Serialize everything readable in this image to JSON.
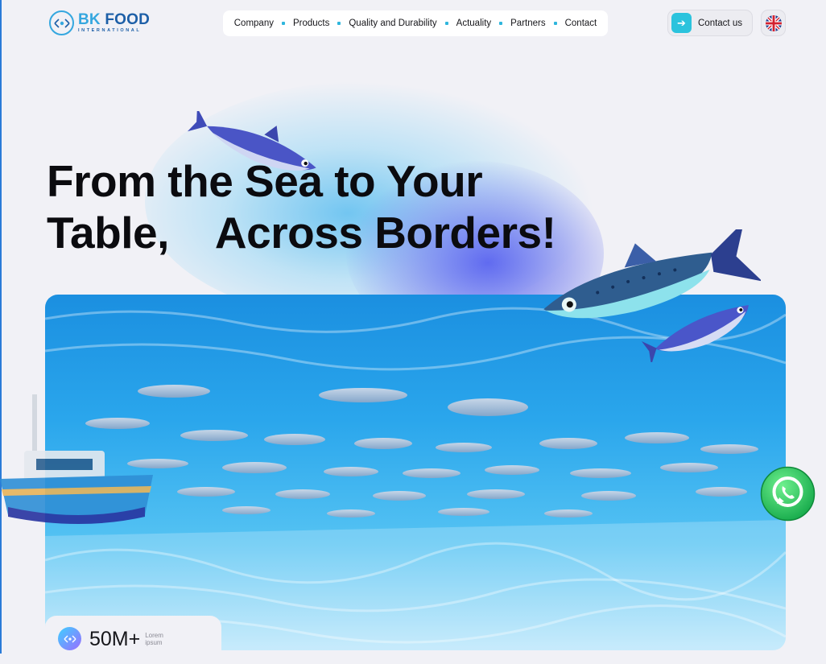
{
  "brand": {
    "name_primary": "BK",
    "name_secondary": "FOOD",
    "tagline": "INTERNATIONAL",
    "accent": "#35a7df",
    "dark": "#1d5fa7"
  },
  "nav": {
    "items": [
      "Company",
      "Products",
      "Quality and Durability",
      "Actuality",
      "Partners",
      "Contact"
    ]
  },
  "header": {
    "contact_button": "Contact us",
    "language_flag": "uk-flag-icon"
  },
  "hero": {
    "headline_line1": "From the Sea to Your",
    "headline_line2": "Table,    Across Borders!"
  },
  "stat": {
    "value": "50M+",
    "note_line1": "Lorem",
    "note_line2": "ipsum"
  },
  "floating": {
    "whatsapp": "whatsapp-icon"
  },
  "colors": {
    "background": "#f1f1f6",
    "nav_dot": "#2fb6dd",
    "contact_accent": "#2bc3dd",
    "whatsapp": "#25d366"
  }
}
